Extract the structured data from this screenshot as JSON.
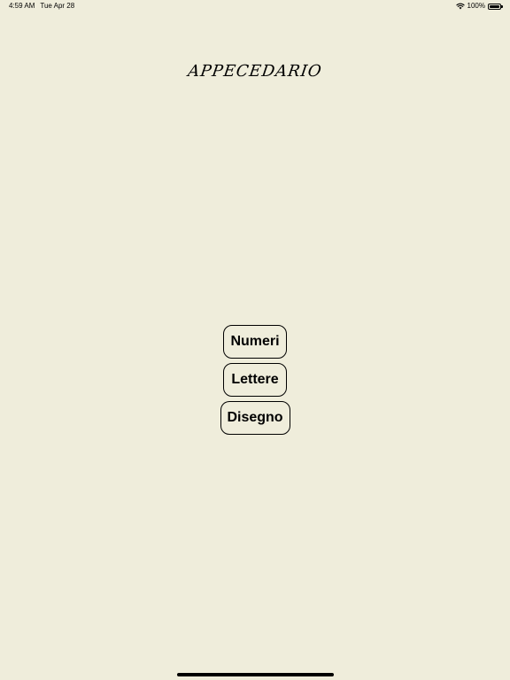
{
  "status_bar": {
    "time": "4:59 AM",
    "date": "Tue Apr 28",
    "battery": "100%",
    "battery_level": 1.0,
    "wifi_icon": "wifi-icon",
    "battery_icon": "battery-icon"
  },
  "app": {
    "title": "APPECEDARIO"
  },
  "menu": {
    "buttons": [
      {
        "label": "Numeri"
      },
      {
        "label": "Lettere"
      },
      {
        "label": "Disegno"
      }
    ]
  },
  "colors": {
    "background": "#efeddb",
    "text": "#000000",
    "button_border": "#000000"
  }
}
